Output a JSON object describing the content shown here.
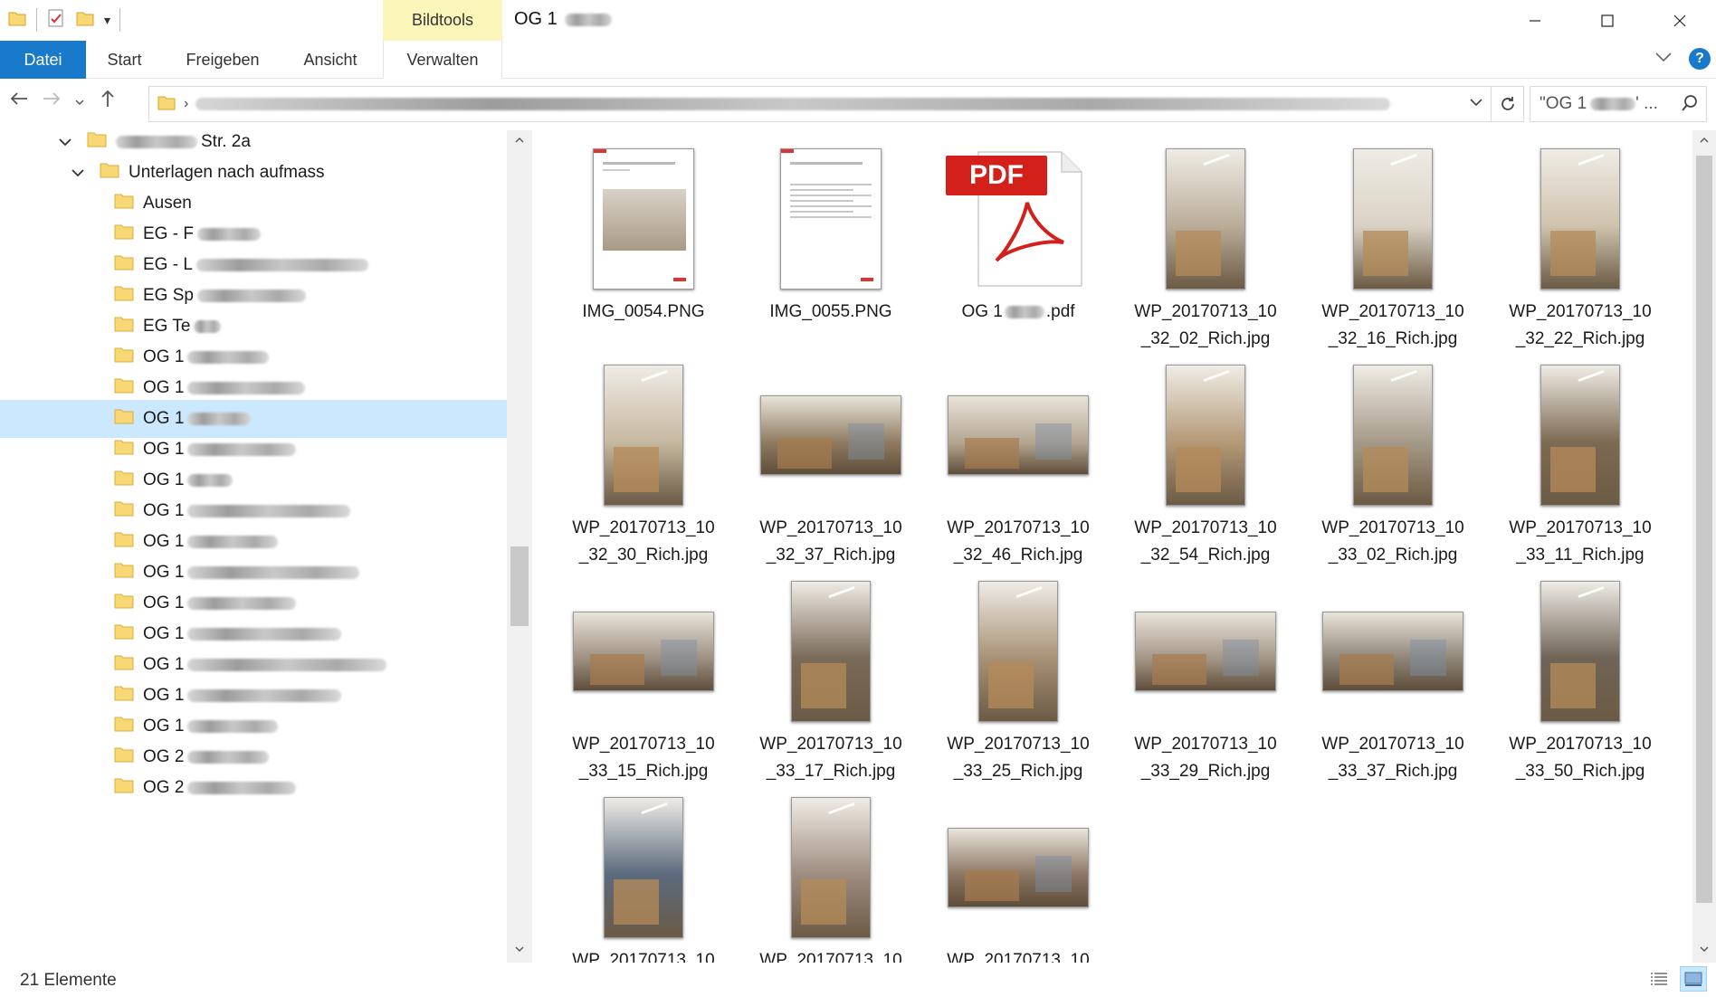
{
  "window": {
    "title": "OG 1",
    "context_tab": "Bildtools"
  },
  "ribbon": {
    "tabs": [
      "Datei",
      "Start",
      "Freigeben",
      "Ansicht",
      "Verwalten"
    ]
  },
  "search": {
    "value": "\"OG 1",
    "ellipsis": "' ..."
  },
  "tree": {
    "items": [
      {
        "label": "Str. 2a",
        "prefix": "",
        "redact_before": 90,
        "redact_after": 0,
        "level": 0,
        "expanded": true
      },
      {
        "label": "Unterlagen nach aufmass",
        "prefix": "",
        "redact_before": 0,
        "redact_after": 0,
        "level": 1,
        "expanded": true
      },
      {
        "label": "Ausen",
        "redact_after": 0,
        "level": 2
      },
      {
        "label": "EG - F",
        "redact_after": 70,
        "level": 2
      },
      {
        "label": "EG - L",
        "redact_after": 190,
        "level": 2
      },
      {
        "label": "EG Sp",
        "redact_after": 120,
        "level": 2
      },
      {
        "label": "EG Te",
        "redact_after": 30,
        "level": 2
      },
      {
        "label": "OG 1",
        "redact_after": 90,
        "level": 2
      },
      {
        "label": "OG 1",
        "redact_after": 130,
        "level": 2
      },
      {
        "label": "OG 1",
        "redact_after": 70,
        "level": 2,
        "selected": true
      },
      {
        "label": "OG 1",
        "redact_after": 120,
        "level": 2
      },
      {
        "label": "OG 1",
        "redact_after": 50,
        "level": 2
      },
      {
        "label": "OG 1",
        "redact_after": 180,
        "level": 2
      },
      {
        "label": "OG 1",
        "redact_after": 100,
        "level": 2
      },
      {
        "label": "OG 1",
        "redact_after": 190,
        "level": 2
      },
      {
        "label": "OG 1",
        "redact_after": 120,
        "level": 2
      },
      {
        "label": "OG 1",
        "redact_after": 170,
        "level": 2
      },
      {
        "label": "OG 1",
        "redact_after": 220,
        "level": 2
      },
      {
        "label": "OG 1",
        "redact_after": 170,
        "level": 2
      },
      {
        "label": "OG 1",
        "redact_after": 100,
        "level": 2
      },
      {
        "label": "OG 2",
        "redact_after": 90,
        "level": 2
      },
      {
        "label": "OG 2",
        "redact_after": 120,
        "level": 2
      }
    ]
  },
  "files": [
    {
      "l1": "IMG_0054.PNG",
      "l2": "",
      "kind": "doc1"
    },
    {
      "l1": "IMG_0055.PNG",
      "l2": "",
      "kind": "doc2"
    },
    {
      "l1": "OG 1",
      "l1b": ".pdf",
      "l2": "",
      "kind": "pdf",
      "pdf_badge": "PDF"
    },
    {
      "l1": "WP_20170713_10",
      "l2": "_32_02_Rich.jpg",
      "kind": "portrait",
      "tone": "#b9ad99"
    },
    {
      "l1": "WP_20170713_10",
      "l2": "_32_16_Rich.jpg",
      "kind": "portrait",
      "tone": "#d9d2c4"
    },
    {
      "l1": "WP_20170713_10",
      "l2": "_32_22_Rich.jpg",
      "kind": "portrait",
      "tone": "#cfc3ad"
    },
    {
      "l1": "WP_20170713_10",
      "l2": "_32_30_Rich.jpg",
      "kind": "portrait",
      "tone": "#c7b8a0"
    },
    {
      "l1": "WP_20170713_10",
      "l2": "_32_37_Rich.jpg",
      "kind": "landscape",
      "tone": "#8e7a60"
    },
    {
      "l1": "WP_20170713_10",
      "l2": "_32_46_Rich.jpg",
      "kind": "landscape",
      "tone": "#b3a590"
    },
    {
      "l1": "WP_20170713_10",
      "l2": "_32_54_Rich.jpg",
      "kind": "portrait",
      "tone": "#b49a77"
    },
    {
      "l1": "WP_20170713_10",
      "l2": "_33_02_Rich.jpg",
      "kind": "portrait",
      "tone": "#a59a88"
    },
    {
      "l1": "WP_20170713_10",
      "l2": "_33_11_Rich.jpg",
      "kind": "portrait",
      "tone": "#7d6a52"
    },
    {
      "l1": "WP_20170713_10",
      "l2": "_33_15_Rich.jpg",
      "kind": "landscape",
      "tone": "#9c8f80"
    },
    {
      "l1": "WP_20170713_10",
      "l2": "_33_17_Rich.jpg",
      "kind": "portrait",
      "tone": "#7a6a58"
    },
    {
      "l1": "WP_20170713_10",
      "l2": "_33_25_Rich.jpg",
      "kind": "portrait",
      "tone": "#a89276"
    },
    {
      "l1": "WP_20170713_10",
      "l2": "_33_29_Rich.jpg",
      "kind": "landscape",
      "tone": "#a39585"
    },
    {
      "l1": "WP_20170713_10",
      "l2": "_33_37_Rich.jpg",
      "kind": "landscape",
      "tone": "#8d8476"
    },
    {
      "l1": "WP_20170713_10",
      "l2": "_33_50_Rich.jpg",
      "kind": "portrait",
      "tone": "#6f6456"
    },
    {
      "l1": "WP_20170713_10",
      "l2": "",
      "kind": "portrait",
      "tone": "#5b6a7d"
    },
    {
      "l1": "WP_20170713_10",
      "l2": "",
      "kind": "portrait",
      "tone": "#9e8d80"
    },
    {
      "l1": "WP_20170713_10",
      "l2": "",
      "kind": "landscape",
      "tone": "#8a7461"
    }
  ],
  "status": {
    "count": "21 Elemente"
  },
  "colors": {
    "accent": "#1979ca",
    "selection": "#cce8ff",
    "context_tab": "#faf6b9",
    "folder": "#f8d775"
  }
}
